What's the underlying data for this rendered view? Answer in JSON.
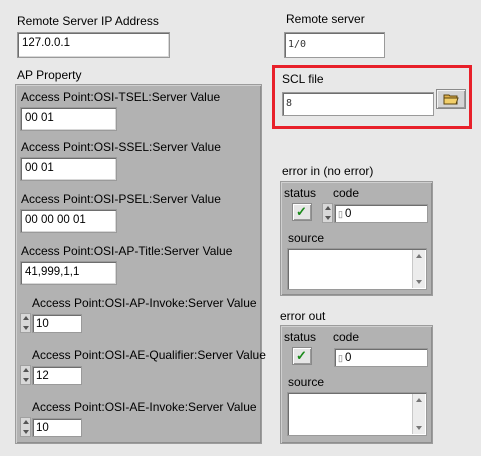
{
  "remote_ip": {
    "label": "Remote Server IP Address",
    "value": "127.0.0.1"
  },
  "remote_server": {
    "label": "Remote server",
    "value": ""
  },
  "scl_file": {
    "label": "SCL file",
    "value": ""
  },
  "ap_property": {
    "label": "AP Property",
    "fields": [
      {
        "label": "Access Point:OSI-TSEL:Server Value",
        "value": "00 01"
      },
      {
        "label": "Access Point:OSI-SSEL:Server Value",
        "value": "00 01"
      },
      {
        "label": "Access Point:OSI-PSEL:Server Value",
        "value": "00 00 00 01"
      },
      {
        "label": "Access Point:OSI-AP-Title:Server Value",
        "value": "41,999,1,1"
      },
      {
        "label": "Access Point:OSI-AP-Invoke:Server Value",
        "value": "10"
      },
      {
        "label": "Access Point:OSI-AE-Qualifier:Server Value",
        "value": "12"
      },
      {
        "label": "Access Point:OSI-AE-Invoke:Server Value",
        "value": "10"
      }
    ]
  },
  "error_in": {
    "label": "error in (no error)",
    "status_label": "status",
    "code_label": "code",
    "code_value": "0",
    "source_label": "source",
    "source_value": ""
  },
  "error_out": {
    "label": "error out",
    "status_label": "status",
    "code_label": "code",
    "code_value": "0",
    "source_label": "source",
    "source_value": ""
  },
  "icons": {
    "status_check": "✓",
    "remote_server_path_glyph": "1/0",
    "scl_path_glyph": "8"
  },
  "colors": {
    "highlight": "#e8202a",
    "check_green": "#1a8a1a",
    "cluster_gray": "#b2b2b2"
  }
}
